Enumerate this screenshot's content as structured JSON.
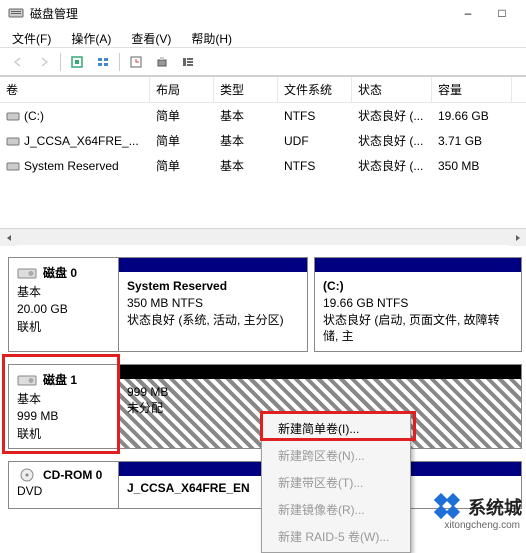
{
  "window": {
    "title": "磁盘管理",
    "sys_minimize": "–",
    "sys_maximize": "□"
  },
  "menu": {
    "file": "文件(F)",
    "action": "操作(A)",
    "view": "查看(V)",
    "help": "帮助(H)"
  },
  "toolbar": {
    "back": "←",
    "forward": "→"
  },
  "table": {
    "headers": {
      "volume": "卷",
      "layout": "布局",
      "type": "类型",
      "fs": "文件系统",
      "status": "状态",
      "capacity": "容量"
    },
    "rows": [
      {
        "volume": "(C:)",
        "layout": "简单",
        "type": "基本",
        "fs": "NTFS",
        "status": "状态良好 (...",
        "capacity": "19.66 GB"
      },
      {
        "volume": "J_CCSA_X64FRE_...",
        "layout": "简单",
        "type": "基本",
        "fs": "UDF",
        "status": "状态良好 (...",
        "capacity": "3.71 GB"
      },
      {
        "volume": "System Reserved",
        "layout": "简单",
        "type": "基本",
        "fs": "NTFS",
        "status": "状态良好 (...",
        "capacity": "350 MB"
      }
    ]
  },
  "disks": {
    "disk0": {
      "name": "磁盘 0",
      "type": "基本",
      "size": "20.00 GB",
      "status": "联机",
      "parts": [
        {
          "name": "System Reserved",
          "info": "350 MB NTFS",
          "detail": "状态良好 (系统, 活动, 主分区)"
        },
        {
          "name": "(C:)",
          "info": "19.66 GB NTFS",
          "detail": "状态良好 (启动, 页面文件, 故障转储, 主"
        }
      ]
    },
    "disk1": {
      "name": "磁盘 1",
      "type": "基本",
      "size": "999 MB",
      "status": "联机",
      "unalloc_size": "999 MB",
      "unalloc_label": "未分配"
    },
    "cdrom": {
      "name": "CD-ROM 0",
      "type": "DVD",
      "part_name": "J_CCSA_X64FRE_EN"
    }
  },
  "context_menu": {
    "items": [
      {
        "label": "新建简单卷(I)...",
        "enabled": true
      },
      {
        "label": "新建跨区卷(N)...",
        "enabled": false
      },
      {
        "label": "新建带区卷(T)...",
        "enabled": false
      },
      {
        "label": "新建镜像卷(R)...",
        "enabled": false
      },
      {
        "label": "新建 RAID-5 卷(W)...",
        "enabled": false
      }
    ]
  },
  "watermark": {
    "text": "系统城",
    "sub": "xitongcheng.com"
  }
}
